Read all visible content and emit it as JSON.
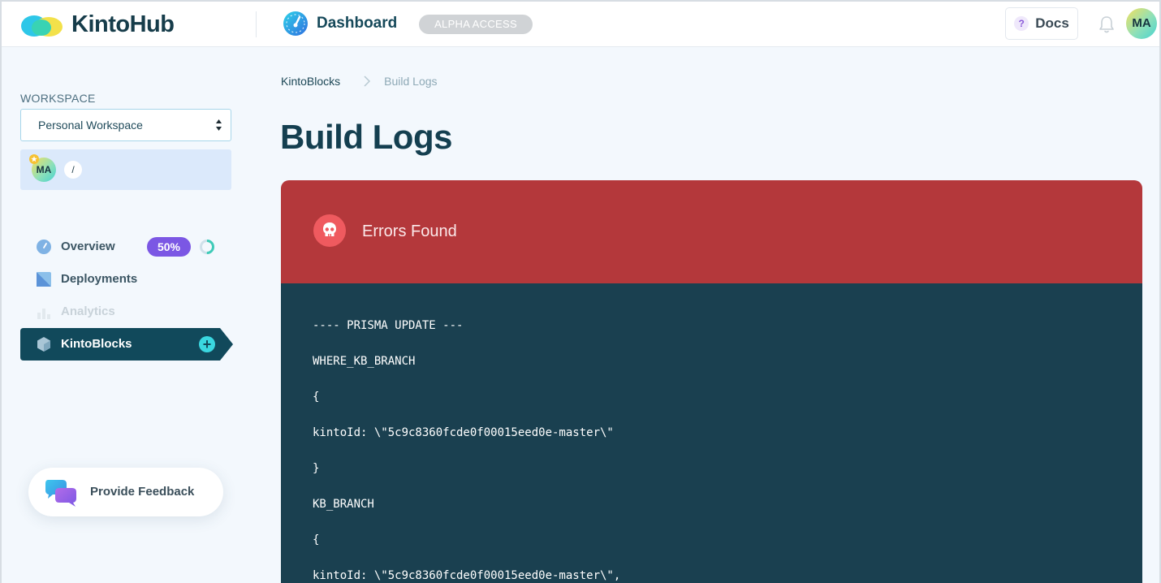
{
  "header": {
    "logo_text": "KintoHub",
    "section_title": "Dashboard",
    "badge": "ALPHA ACCESS",
    "docs_label": "Docs",
    "docs_icon_glyph": "?",
    "avatar_initials": "MA"
  },
  "sidebar": {
    "workspace_label": "WORKSPACE",
    "workspace_selected": "Personal Workspace",
    "member_initials": "MA",
    "member_edit_glyph": "/",
    "nav": [
      {
        "label": "Overview",
        "icon": "gauge-icon",
        "progress_percent": 50,
        "progress_label": "50%"
      },
      {
        "label": "Deployments",
        "icon": "deployments-icon"
      },
      {
        "label": "Analytics",
        "icon": "bar-chart-icon",
        "disabled": true
      },
      {
        "label": "KintoBlocks",
        "icon": "hexagon-icon",
        "active": true,
        "plus_glyph": "+"
      }
    ],
    "feedback_label": "Provide Feedback"
  },
  "main": {
    "breadcrumb": {
      "parent": "KintoBlocks",
      "current": "Build Logs"
    },
    "title": "Build Logs",
    "status_title": "Errors Found",
    "status_color": "#b4383b",
    "log_lines": [
      "---- PRISMA UPDATE ---",
      "WHERE_KB_BRANCH",
      "{",
      "kintoId: \\\"5c9c8360fcde0f00015eed0e-master\\\"",
      "}",
      "KB_BRANCH",
      "{",
      "kintoId: \\\"5c9c8360fcde0f00015eed0e-master\\\","
    ]
  },
  "colors": {
    "brand_dark": "#143f50",
    "active_nav": "#11495b",
    "log_bg": "#1a4050",
    "badge_purple": "#7b57e4",
    "accent_cyan": "#3ad7e0"
  }
}
